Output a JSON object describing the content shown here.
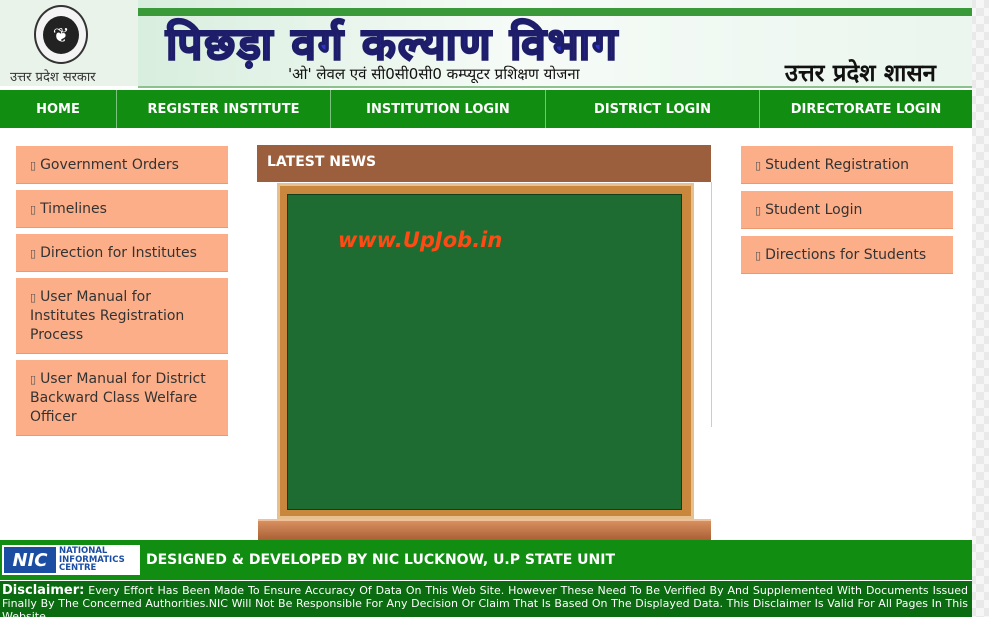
{
  "header": {
    "state_label": "उत्तर प्रदेश सरकार",
    "title": "पिछड़ा वर्ग कल्याण विभाग",
    "subtitle": "'ओ' लेवल एवं सी0सी0सी0 कम्प्यूटर प्रशिक्षण योजना",
    "government": "उत्तर प्रदेश शासन"
  },
  "nav": {
    "items": [
      "HOME",
      "REGISTER INSTITUTE",
      "INSTITUTION LOGIN",
      "DISTRICT LOGIN",
      "DIRECTORATE LOGIN"
    ]
  },
  "left_menu": {
    "items": [
      "Government Orders",
      "Timelines",
      "Direction for Institutes",
      "User Manual for Institutes Registration Process",
      "User Manual for District Backward Class Welfare Officer"
    ]
  },
  "right_menu": {
    "items": [
      "Student Registration",
      "Student Login",
      "Directions for Students"
    ]
  },
  "news": {
    "heading": "LATEST NEWS",
    "board_text": "www.UpJob.in"
  },
  "footer": {
    "nic_logo_mark": "NIC",
    "nic_logo_text": [
      "NATIONAL",
      "INFORMATICS",
      "CENTRE"
    ],
    "credit": "DESIGNED & DEVELOPED BY NIC LUCKNOW, U.P STATE UNIT",
    "disclaimer_label": "Disclaimer:",
    "disclaimer_text": "Every Effort Has Been Made To Ensure Accuracy Of Data On This Web Site. However These Need To Be Verified By And Supplemented With Documents Issued Finally By The Concerned Authorities.NIC Will Not Be Responsible For Any Decision Or Claim That Is Based On The Displayed Data. This Disclaimer Is Valid For All Pages In This Website."
  },
  "colors": {
    "nav_green": "#118e11",
    "menu_peach": "#fcae88",
    "news_brown": "#9b5f3e",
    "board_green": "#1f6c32",
    "board_text": "#ff4a14"
  },
  "icons": {
    "menu_item": "missing-glyph-icon",
    "emblem": "up-emblem-icon"
  }
}
